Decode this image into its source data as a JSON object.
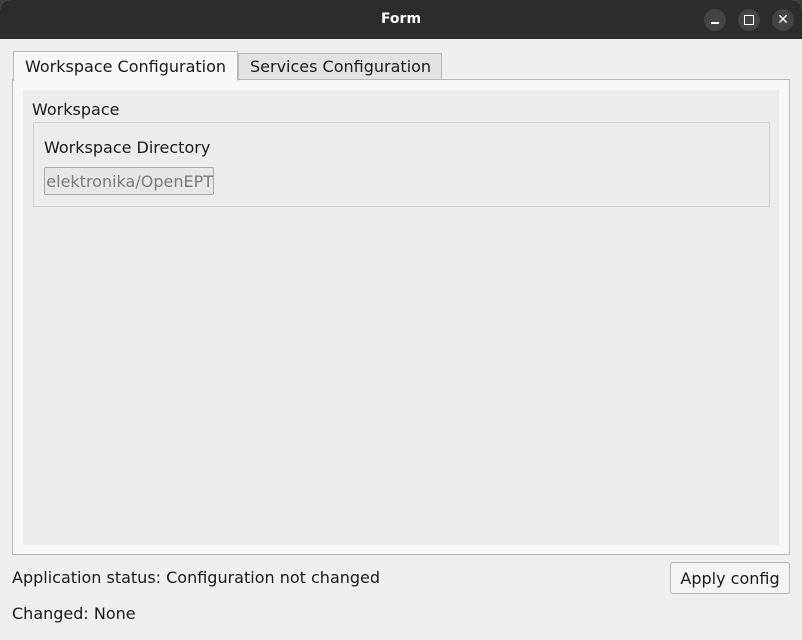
{
  "window": {
    "title": "Form",
    "controls": {
      "minimize": "minimize-icon",
      "maximize": "maximize-icon",
      "close": "close-icon",
      "close_glyph": "✕"
    }
  },
  "tabs": [
    {
      "label": "Workspace Configuration",
      "active": true
    },
    {
      "label": "Services Configuration",
      "active": false
    }
  ],
  "workspace": {
    "group_label": "Workspace",
    "directory_label": "Workspace Directory",
    "directory_value": "elektronika/OpenEPT"
  },
  "footer": {
    "status_text": "Application status: Configuration not changed",
    "changed_text": "Changed: None",
    "apply_label": "Apply config"
  }
}
